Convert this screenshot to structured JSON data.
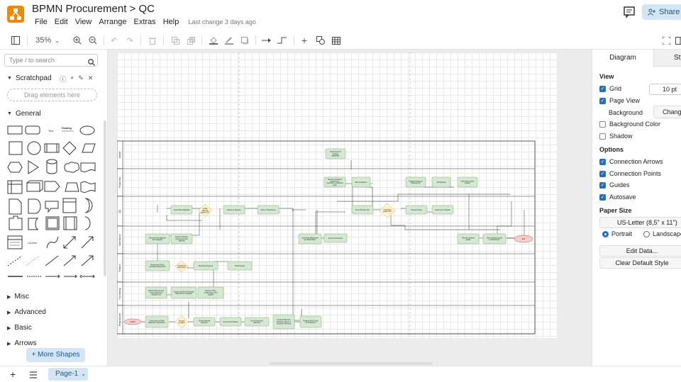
{
  "header": {
    "title": "BPMN Procurement > QC",
    "menus": [
      "File",
      "Edit",
      "View",
      "Arrange",
      "Extras",
      "Help"
    ],
    "last_change": "Last change 3 days ago",
    "share_label": "Share"
  },
  "toolbar": {
    "zoom": "35%"
  },
  "left_panel": {
    "search_placeholder": "Type / to search",
    "scratchpad_label": "Scratchpad",
    "drop_hint": "Drag elements here",
    "general_label": "General",
    "collapsed_sections": [
      "Misc",
      "Advanced",
      "Basic",
      "Arrows"
    ],
    "shape_labels": [
      "Text",
      "Heading",
      "List Item"
    ],
    "more_shapes": "+ More Shapes"
  },
  "diagram": {
    "lanes": [
      "Vendor",
      "Production",
      "QC",
      "Warehouse",
      "Finance",
      "Purchasing",
      "Requisitioner"
    ],
    "nodes": [
      "Check stock for process availability",
      "Prepare production requirement, production scheduled order",
      "Plan production",
      "Transfer product to Packing Unit",
      "Do Packing",
      "Label and receive product",
      "Check Raw Materials",
      "Is Raw Material quality OK?",
      "Return to Supplier",
      "Store in Warehouse",
      "Do In-Process QC",
      "Is product quality OK?",
      "Process Scrap",
      "Reprocess / Rework",
      "Receive Raw Material from Supplier",
      "Receive Delivery Documents and Material",
      "Issue Raw Material as per Work Order",
      "Send to Production",
      "Receive finished goods",
      "Store finished goods in Warehouse",
      "End",
      "Review and Verify Purchase Documents",
      "Is payment approved?",
      "Purchase Payment",
      "Hold Process",
      "Review Request and Check Approved Supplier List",
      "Create and Send Purchase Order (PO) to Supplier",
      "Receive Order Confirmation from Supplier",
      "START",
      "Check stock of Raw Material in warehouse",
      "Is stock enough?",
      "Create Material Request",
      "Send to Purchasing",
      "Go to Production Planning",
      "Create Production Schedule based on Customer Demand",
      "Prepare Work Order for Production"
    ]
  },
  "right_panel": {
    "tabs": [
      "Diagram",
      "Style"
    ],
    "view_label": "View",
    "grid_label": "Grid",
    "grid_size": "10 pt",
    "page_view_label": "Page View",
    "background_label": "Background",
    "change_label": "Change...",
    "bg_color_label": "Background Color",
    "shadow_label": "Shadow",
    "options_label": "Options",
    "connection_arrows": "Connection Arrows",
    "connection_points": "Connection Points",
    "guides": "Guides",
    "autosave": "Autosave",
    "paper_size_label": "Paper Size",
    "paper_size": "US-Letter (8,5\" x 11\")",
    "portrait": "Portrait",
    "landscape": "Landscape",
    "edit_data": "Edit Data...",
    "clear_style": "Clear Default Style"
  },
  "bottom": {
    "page_tab": "Page-1"
  },
  "colors": {
    "accent": "#1f6fcb",
    "node_fill": "#d5e8d4",
    "node_stroke": "#82b366",
    "decision_fill": "#fff2cc",
    "end_fill": "#f8cecc"
  }
}
